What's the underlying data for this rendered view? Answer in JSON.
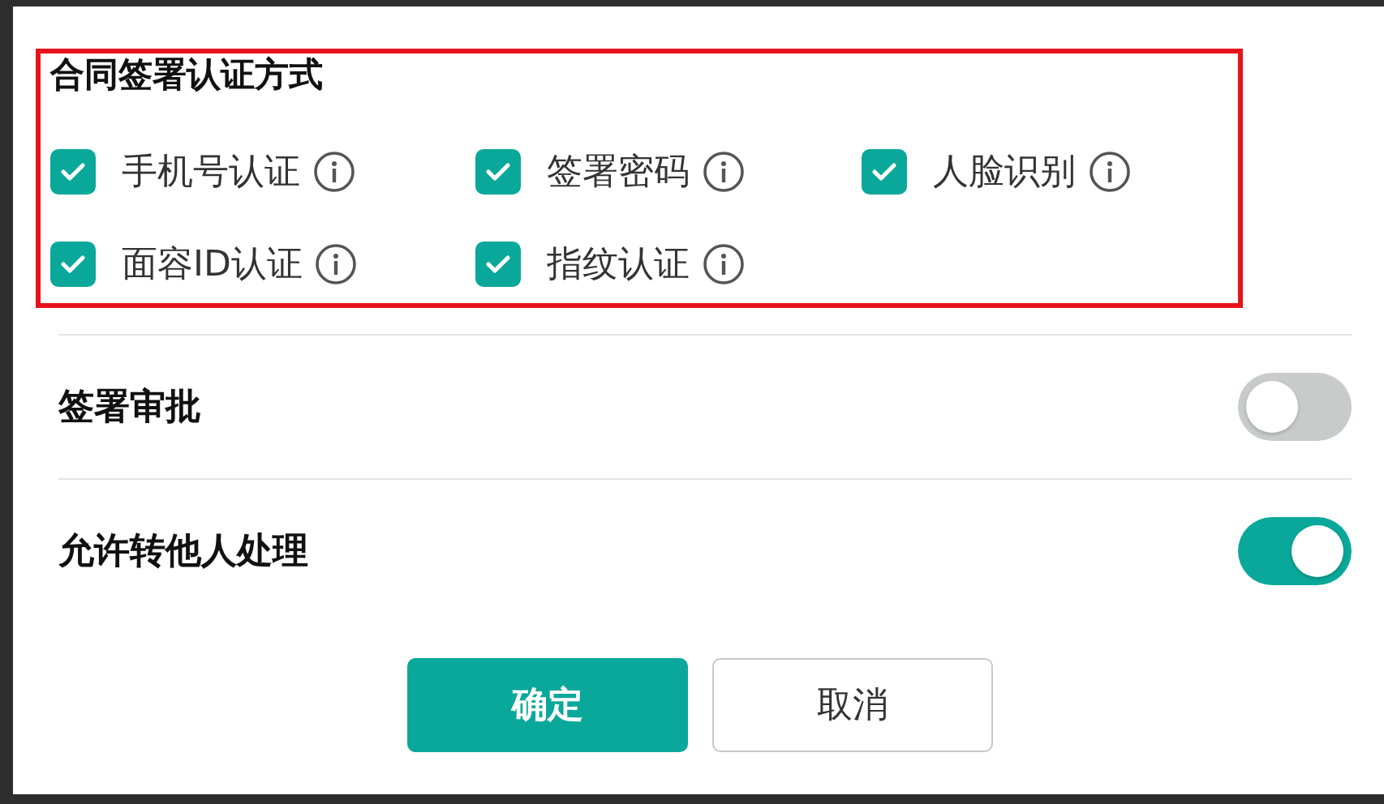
{
  "auth_section": {
    "title": "合同签署认证方式",
    "methods": [
      {
        "label": "手机号认证",
        "checked": true
      },
      {
        "label": "签署密码",
        "checked": true
      },
      {
        "label": "人脸识别",
        "checked": true
      },
      {
        "label": "面容ID认证",
        "checked": true
      },
      {
        "label": "指纹认证",
        "checked": true
      }
    ]
  },
  "settings": [
    {
      "label": "签署审批",
      "on": false
    },
    {
      "label": "允许转他人处理",
      "on": true
    }
  ],
  "buttons": [
    {
      "label": "确定",
      "kind": "primary"
    },
    {
      "label": "取消",
      "kind": "secondary"
    }
  ]
}
